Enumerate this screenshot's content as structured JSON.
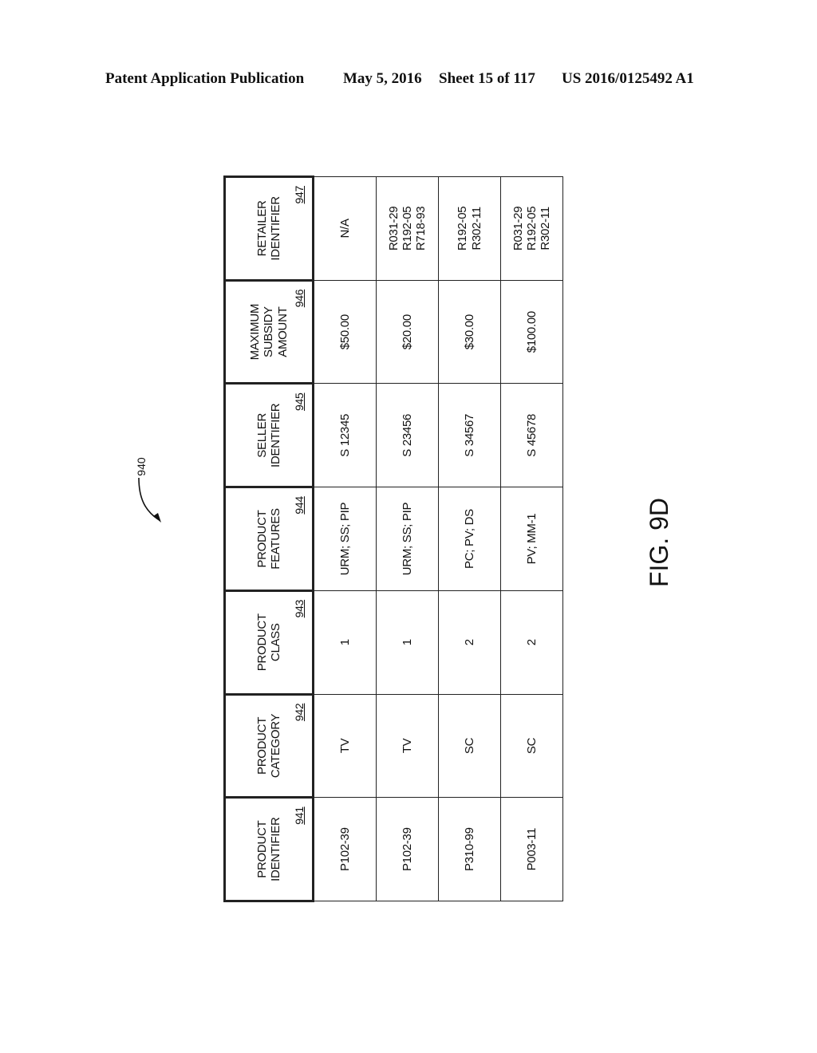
{
  "page_header": {
    "publication": "Patent Application Publication",
    "date": "May 5, 2016",
    "sheet": "Sheet 15 of 117",
    "number": "US 2016/0125492 A1"
  },
  "figure": {
    "reference": "940",
    "label": "FIG. 9D"
  },
  "table": {
    "columns": [
      {
        "label": "PRODUCT\nIDENTIFIER",
        "ref": "941"
      },
      {
        "label": "PRODUCT\nCATEGORY",
        "ref": "942"
      },
      {
        "label": "PRODUCT\nCLASS",
        "ref": "943"
      },
      {
        "label": "PRODUCT\nFEATURES",
        "ref": "944"
      },
      {
        "label": "SELLER\nIDENTIFIER",
        "ref": "945"
      },
      {
        "label": "MAXIMUM\nSUBSIDY\nAMOUNT",
        "ref": "946"
      },
      {
        "label": "RETAILER\nIDENTIFIER",
        "ref": "947"
      }
    ],
    "rows": [
      [
        "P102-39",
        "TV",
        "1",
        "URM; SS; PIP",
        "S 12345",
        "$50.00",
        "N/A"
      ],
      [
        "P102-39",
        "TV",
        "1",
        "URM; SS; PIP",
        "S 23456",
        "$20.00",
        "R031-29\nR192-05\nR718-93"
      ],
      [
        "P310-99",
        "SC",
        "2",
        "PC; PV; DS",
        "S 34567",
        "$30.00",
        "R192-05\nR302-11"
      ],
      [
        "P003-11",
        "SC",
        "2",
        "PV; MM-1",
        "S 45678",
        "$100.00",
        "R031-29\nR192-05\nR302-11"
      ]
    ]
  }
}
